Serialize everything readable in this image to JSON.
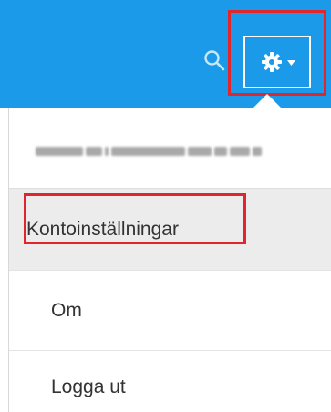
{
  "header": {
    "background": "#1a9ae8",
    "icons": [
      "search-icon",
      "gear-icon",
      "caret-down-icon"
    ]
  },
  "menu": {
    "items": [
      {
        "label": "Kontoinställningar",
        "highlighted": true
      },
      {
        "label": "Om"
      },
      {
        "label": "Logga ut"
      }
    ]
  },
  "annotation_color": "#e0262c"
}
